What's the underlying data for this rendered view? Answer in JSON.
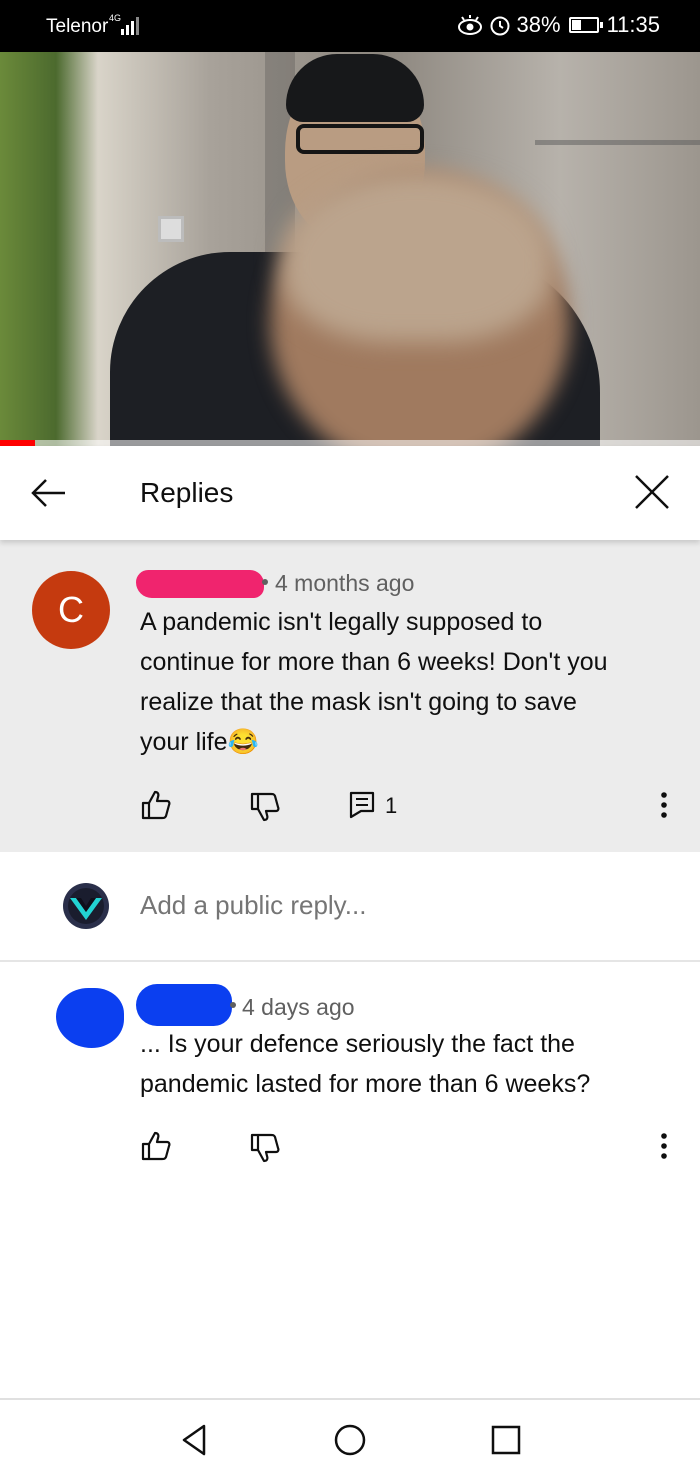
{
  "status_bar": {
    "carrier": "Telenor",
    "network_type": "4G",
    "battery_percent": "38%",
    "battery_level": 0.38,
    "time": "11:35"
  },
  "video": {
    "progress": 0.05
  },
  "header": {
    "title": "Replies"
  },
  "parent_comment": {
    "avatar_letter": "C",
    "avatar_color": "#c53a0f",
    "time": "4 months ago",
    "text_lines": [
      "A pandemic isn't legally supposed to",
      "continue for more than 6 weeks! Don't you",
      "realize that the mask isn't going to save",
      "your life😂"
    ],
    "reply_count": "1"
  },
  "add_reply": {
    "placeholder": "Add a public reply..."
  },
  "reply": {
    "time": "4 days ago",
    "text_lines": [
      "... Is your defence seriously the fact the",
      "pandemic lasted for more than 6 weeks?"
    ]
  },
  "icons": {
    "back": "arrow-left-icon",
    "close": "close-icon",
    "like": "thumbs-up-icon",
    "dislike": "thumbs-down-icon",
    "reply": "comment-icon",
    "more": "more-vert-icon",
    "nav_back": "triangle-back-icon",
    "nav_home": "circle-home-icon",
    "nav_recent": "square-recents-icon"
  },
  "colors": {
    "progress": "#ff0000",
    "redaction_pink": "#f0246e",
    "redaction_blue": "#0b3ff0"
  }
}
